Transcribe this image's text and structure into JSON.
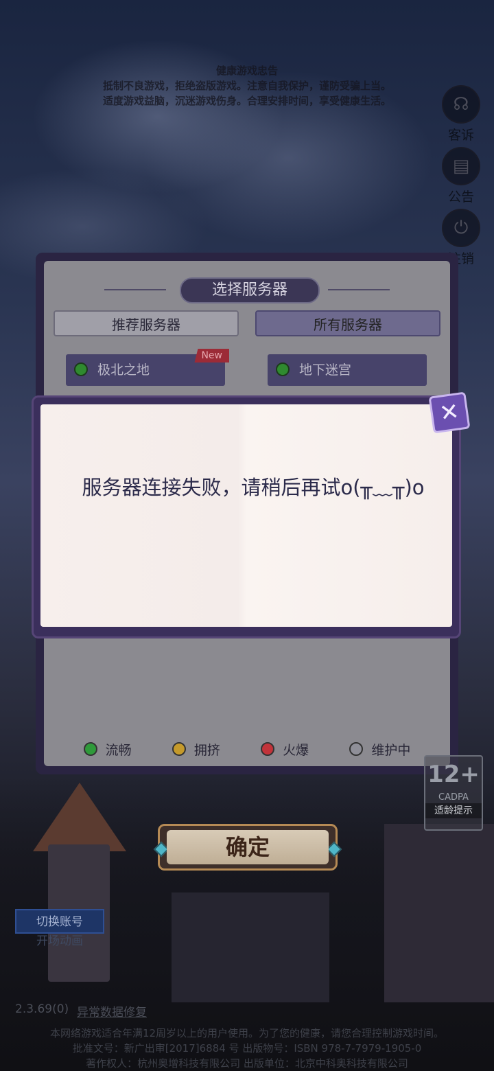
{
  "warning": {
    "title": "健康游戏忠告",
    "line1": "抵制不良游戏，拒绝盗版游戏。注意自我保护，谨防受骗上当。",
    "line2": "适度游戏益脑，沉迷游戏伤身。合理安排时间，享受健康生活。"
  },
  "side": {
    "complaint": "客诉",
    "notice": "公告",
    "logout": "注销"
  },
  "server_panel": {
    "title": "选择服务器",
    "tab_recommended": "推荐服务器",
    "tab_all": "所有服务器",
    "servers": [
      {
        "name": "极北之地",
        "badge": "New",
        "status_color": "#2f8a2f"
      },
      {
        "name": "地下迷宫",
        "badge": "",
        "status_color": "#2f8a2f"
      }
    ],
    "legend": [
      {
        "label": "流畅",
        "color": "#2f9a3a"
      },
      {
        "label": "拥挤",
        "color": "#c59a2b"
      },
      {
        "label": "火爆",
        "color": "#c2333a"
      },
      {
        "label": "维护中",
        "color": "#8f8f98"
      }
    ]
  },
  "modal": {
    "message": "服务器连接失败，请稍后再试o(╥﹏╥)o",
    "close_icon": "close-x"
  },
  "confirm_label": "确定",
  "age_badge": {
    "number": "12+",
    "org": "CADPA",
    "tip": "适龄提示"
  },
  "switch_account": "切换账号",
  "opening_animation": "开场动画",
  "version": "2.3.69(0)",
  "repair": "异常数据修复",
  "footer": {
    "line1": "本网络游戏适合年满12周岁以上的用户使用。为了您的健康，请您合理控制游戏时间。",
    "line2": "批准文号：新广出审[2017]6884 号 出版物号：ISBN 978-7-7979-1905-0",
    "line3": "著作权人：杭州奥增科技有限公司 出版单位：北京中科奥科技有限公司"
  }
}
